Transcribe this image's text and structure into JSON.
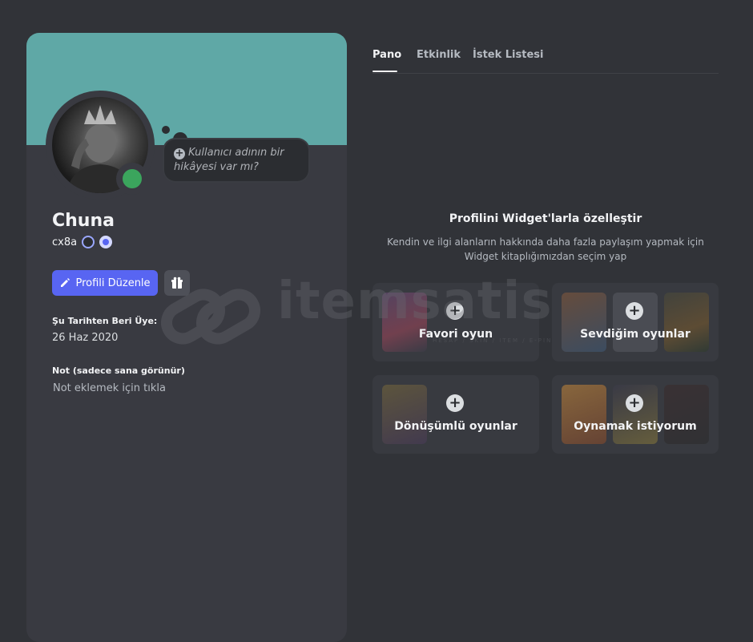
{
  "profile": {
    "display_name": "Chuna",
    "username": "cx8a",
    "story_prompt": "Kullanıcı adının bir hikâyesi var mı?",
    "edit_button": "Profili Düzenle",
    "member_since_label": "Şu Tarihten Beri Üye:",
    "member_since_value": "26 Haz 2020",
    "note_label": "Not (sadece sana görünür)",
    "note_placeholder": "Not eklemek için tıkla",
    "status": "online",
    "banner_color": "#5fa8a6"
  },
  "tabs": [
    {
      "label": "Pano",
      "active": true
    },
    {
      "label": "Etkinlik",
      "active": false
    },
    {
      "label": "İstek Listesi",
      "active": false
    }
  ],
  "empty_state": {
    "title": "Profilini Widget'larla özelleştir",
    "description": "Kendin ve ilgi alanların hakkında daha fazla paylaşım yapmak için Widget kitaplığımızdan seçim yap"
  },
  "widgets": [
    {
      "label": "Favori oyun"
    },
    {
      "label": "Sevdiğim oyunlar"
    },
    {
      "label": "Dönüşümlü oyunlar"
    },
    {
      "label": "Oynamak istiyorum"
    }
  ],
  "watermark": {
    "text": "itemsatis",
    "subtitle": "HESAP / SKIN / ITEM / E-PIN"
  },
  "colors": {
    "accent": "#5865f2",
    "online": "#3ba55d"
  }
}
